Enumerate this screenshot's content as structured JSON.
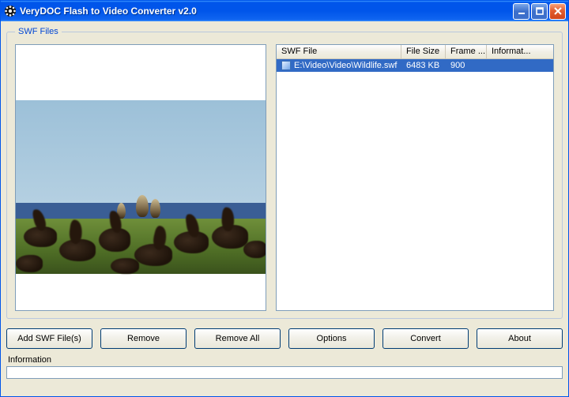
{
  "window": {
    "title": "VeryDOC Flash to Video Converter v2.0"
  },
  "group": {
    "legend": "SWF Files"
  },
  "columns": {
    "file": "SWF File",
    "size": "File Size",
    "frame": "Frame ...",
    "info": "Informat..."
  },
  "files": [
    {
      "path": "E:\\Video\\Video\\Wildlife.swf",
      "size": "6483 KB",
      "frame": "900",
      "info": ""
    }
  ],
  "buttons": {
    "add": "Add SWF File(s)",
    "remove": "Remove",
    "removeAll": "Remove All",
    "options": "Options",
    "convert": "Convert",
    "about": "About"
  },
  "info": {
    "label": "Information",
    "value": ""
  }
}
